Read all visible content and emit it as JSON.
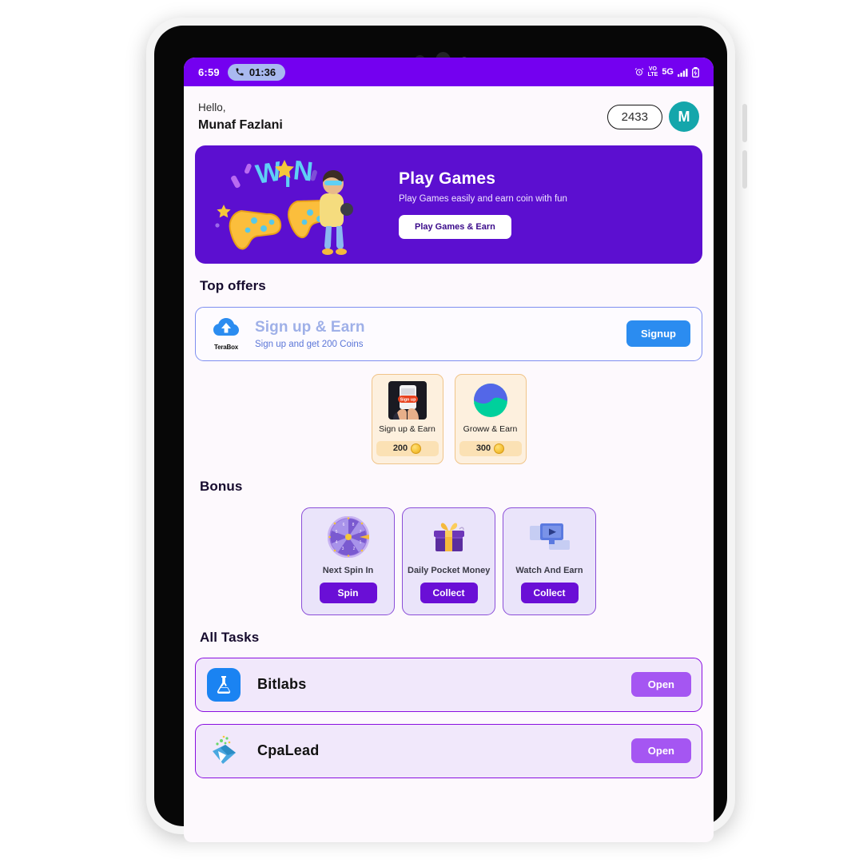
{
  "status_bar": {
    "time": "6:59",
    "call_duration": "01:36",
    "network_type": "5G",
    "volte_label": "VoLTE",
    "icons": [
      "alarm-icon",
      "volte-icon",
      "network-5g-icon",
      "signal-bars-icon",
      "battery-icon"
    ]
  },
  "header": {
    "greeting": "Hello,",
    "user_name": "Munaf Fazlani",
    "coin_balance": "2433",
    "avatar_initial": "M"
  },
  "banner": {
    "title": "Play Games",
    "subtitle": "Play Games easily and earn coin with fun",
    "button_label": "Play Games & Earn",
    "art_text": "WIN",
    "background_color": "#5c0fd0"
  },
  "top_offers": {
    "section_title": "Top offers",
    "featured": {
      "brand": "TeraBox",
      "title": "Sign up & Earn",
      "subtitle": "Sign up and get 200 Coins",
      "button_label": "Signup",
      "button_color": "#2b8cf0"
    },
    "cards": [
      {
        "label": "Sign up & Earn",
        "coins": "200",
        "icon": "signup-phone-icon"
      },
      {
        "label": "Groww  & Earn",
        "coins": "300",
        "icon": "groww-icon"
      }
    ]
  },
  "bonus": {
    "section_title": "Bonus",
    "cards": [
      {
        "label": "Next Spin In",
        "button_label": "Spin",
        "icon": "spin-wheel-icon"
      },
      {
        "label": "Daily Pocket Money",
        "button_label": "Collect",
        "icon": "gift-box-icon"
      },
      {
        "label": "Watch And Earn",
        "button_label": "Collect",
        "icon": "video-play-icon"
      }
    ]
  },
  "all_tasks": {
    "section_title": "All Tasks",
    "rows": [
      {
        "name": "Bitlabs",
        "button_label": "Open",
        "icon": "bitlabs-flask-icon"
      },
      {
        "name": "CpaLead",
        "button_label": "Open",
        "icon": "cpalead-icon"
      }
    ]
  },
  "theme": {
    "primary_purple": "#7400f0",
    "screen_bg": "#fdf9fd",
    "accent_violet": "#6a0fd6"
  }
}
